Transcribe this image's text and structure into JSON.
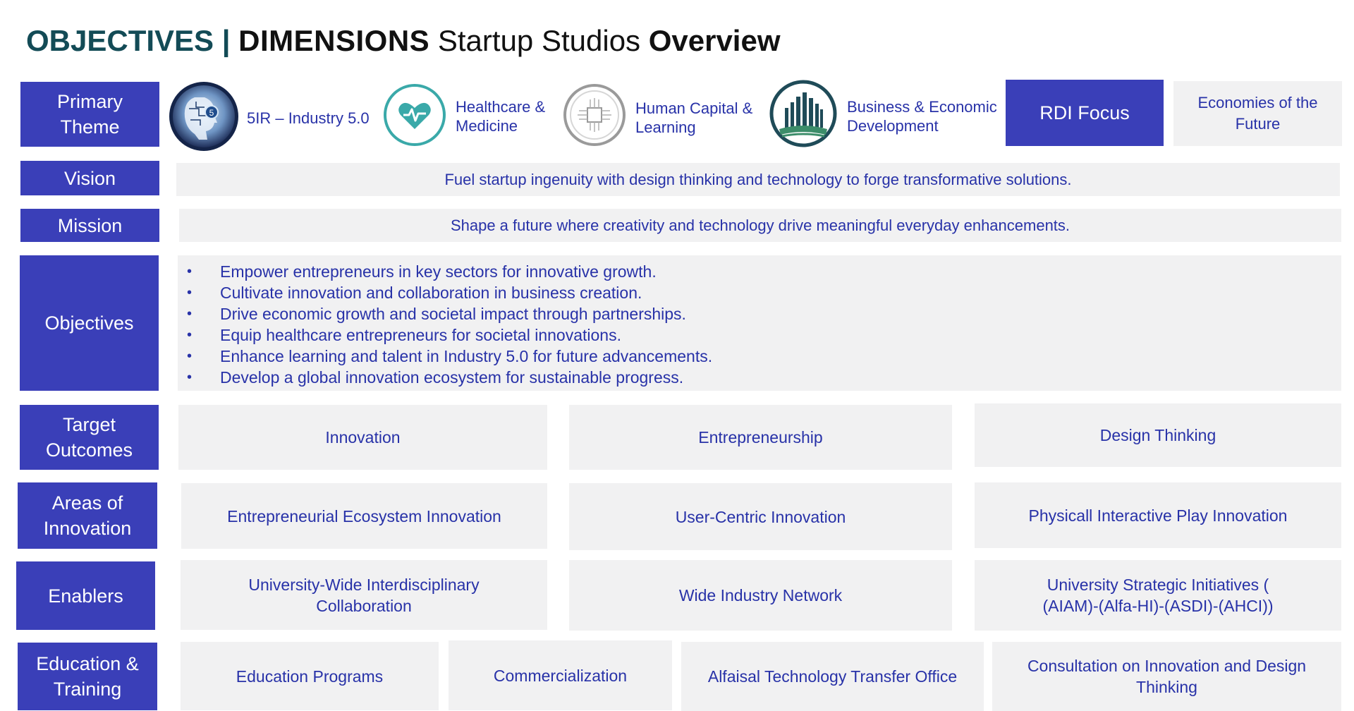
{
  "title": {
    "objectives": "OBJECTIVES |",
    "dimensions": "DIMENSIONS",
    "startup": "Startup Studios",
    "overview": "Overview"
  },
  "labels": {
    "primary_theme": "Primary Theme",
    "vision": "Vision",
    "mission": "Mission",
    "objectives": "Objectives",
    "target_outcomes": "Target Outcomes",
    "areas": "Areas of Innovation",
    "enablers": "Enablers",
    "education": "Education & Training"
  },
  "themes": [
    {
      "label": "5IR –  Industry 5.0",
      "icon": "robot-head-icon"
    },
    {
      "label": "Healthcare & Medicine",
      "icon": "heart-icon"
    },
    {
      "label": "Human Capital & Learning",
      "icon": "circuit-icon"
    },
    {
      "label": "Business & Economic Development",
      "icon": "city-icon"
    }
  ],
  "rdi_focus": "RDI Focus",
  "economies": "Economies of the Future",
  "vision": "Fuel startup ingenuity with design thinking and technology to forge transformative solutions.",
  "mission": "Shape a future where creativity and technology drive meaningful everyday enhancements.",
  "objectives": [
    "Empower entrepreneurs in key sectors for innovative growth.",
    "Cultivate innovation and collaboration in business creation.",
    "Drive economic growth and societal impact through partnerships.",
    "Equip healthcare entrepreneurs for societal innovations.",
    "Enhance learning and talent in Industry 5.0 for future advancements.",
    "Develop a global innovation ecosystem for sustainable progress."
  ],
  "bullet": "•",
  "target_outcomes": [
    "Innovation",
    "Entrepreneurship",
    "Design Thinking"
  ],
  "areas": [
    "Entrepreneurial Ecosystem Innovation",
    "User-Centric Innovation",
    "Physicall Interactive Play Innovation"
  ],
  "enablers": [
    "University-Wide Interdisciplinary Collaboration",
    "Wide Industry Network",
    "University Strategic Initiatives ( (AIAM)-(Alfa-HI)-(ASDI)-(AHCI))"
  ],
  "education": [
    "Education Programs",
    "Commercialization",
    "Alfaisal Technology Transfer Office",
    "Consultation on Innovation and Design Thinking"
  ],
  "colors": {
    "header_bg": "#3a3fb8",
    "box_bg": "#f1f1f2",
    "text_blue": "#2832a8",
    "title_teal": "#134b56"
  }
}
